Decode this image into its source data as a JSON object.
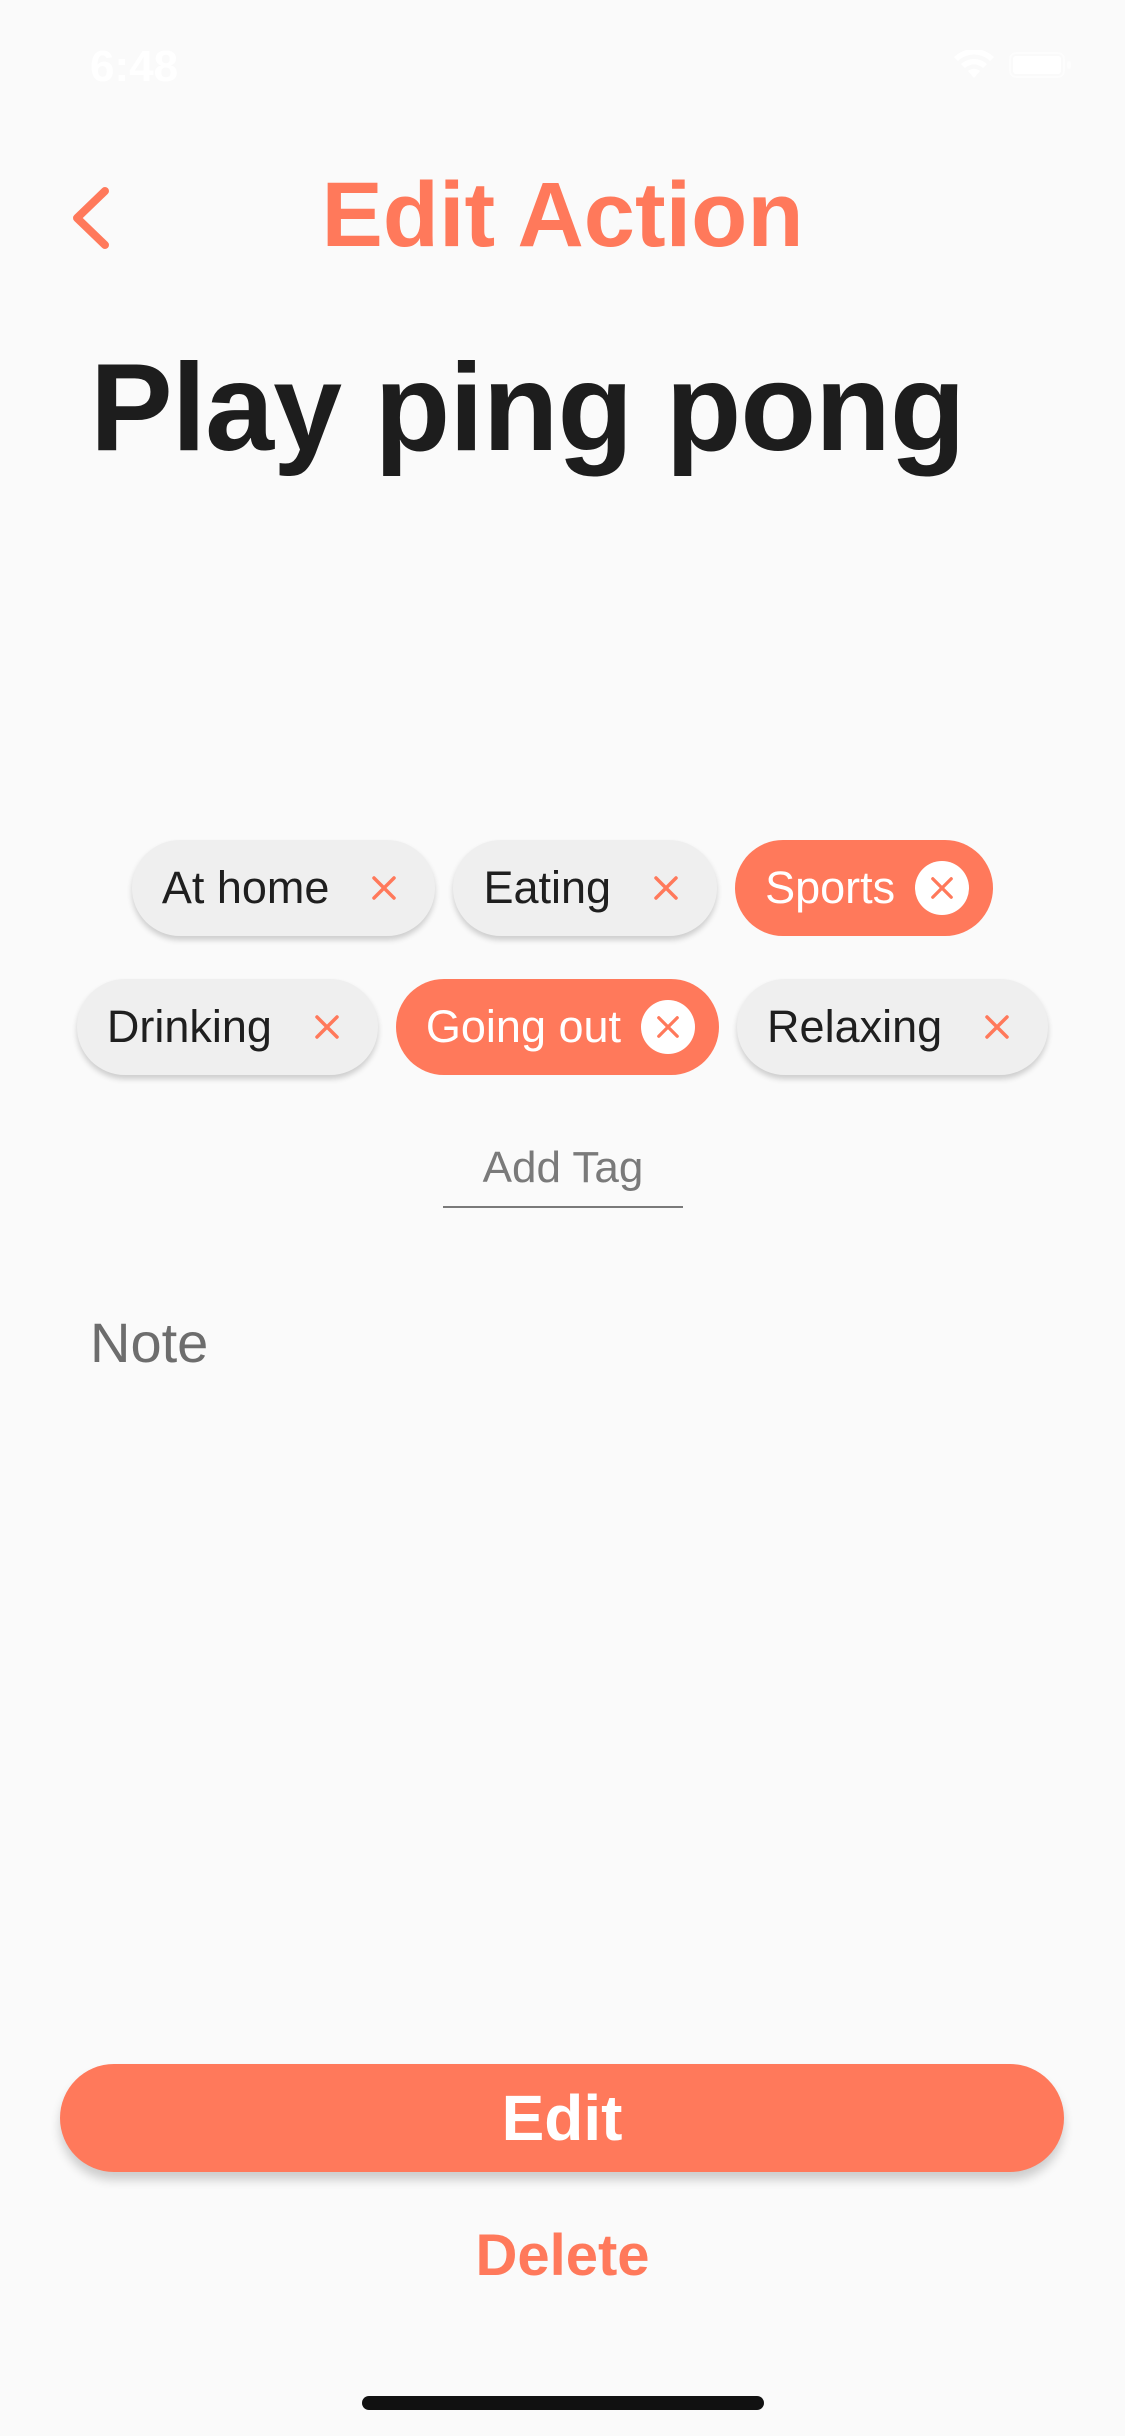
{
  "status_bar": {
    "time": "6:48",
    "wifi_icon": "wifi-icon",
    "battery_icon": "battery-icon"
  },
  "header": {
    "back_icon": "chevron-left-icon",
    "title": "Edit Action"
  },
  "action": {
    "title": "Play ping pong"
  },
  "tags": {
    "row1": [
      {
        "label": "At home",
        "selected": false
      },
      {
        "label": "Eating",
        "selected": false
      },
      {
        "label": "Sports",
        "selected": true
      }
    ],
    "row2": [
      {
        "label": "Drinking",
        "selected": false
      },
      {
        "label": "Going out",
        "selected": true
      },
      {
        "label": "Relaxing",
        "selected": false
      }
    ],
    "remove_icon": "close-icon",
    "add_placeholder": "Add Tag"
  },
  "note": {
    "placeholder": "Note"
  },
  "buttons": {
    "edit_label": "Edit",
    "delete_label": "Delete"
  },
  "colors": {
    "accent": "#ff795b",
    "chip_bg": "#efefef",
    "background": "#fafafa",
    "title_text": "#1d1d1d"
  }
}
